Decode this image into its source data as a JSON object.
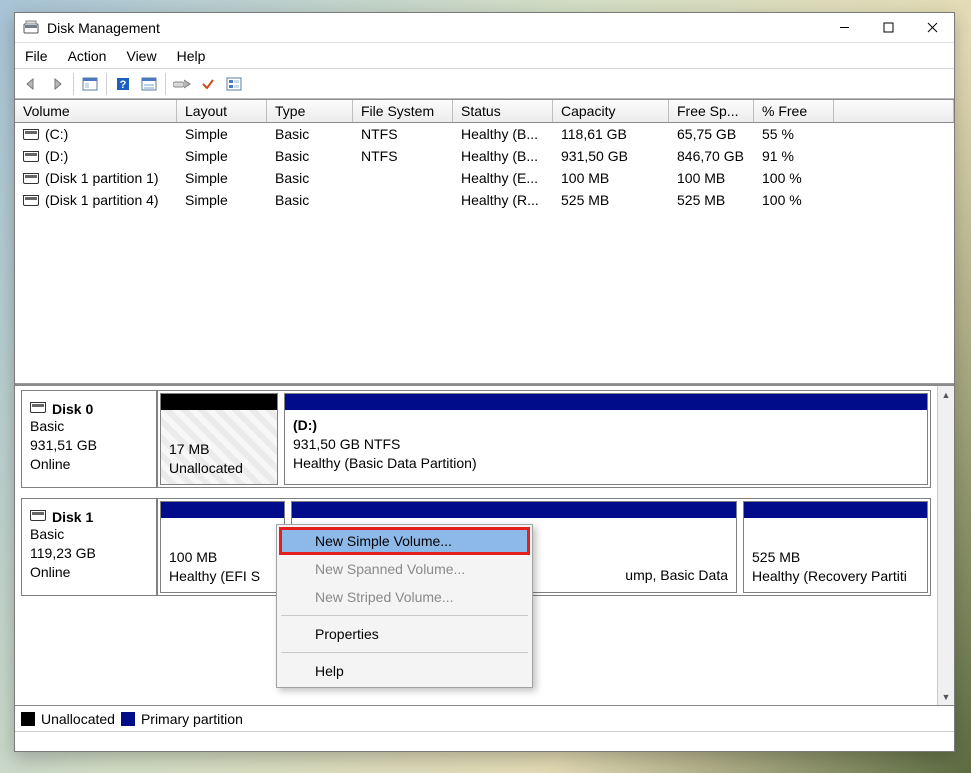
{
  "window": {
    "title": "Disk Management"
  },
  "menu": {
    "file": "File",
    "action": "Action",
    "view": "View",
    "help": "Help"
  },
  "vol": {
    "cols": [
      "Volume",
      "Layout",
      "Type",
      "File System",
      "Status",
      "Capacity",
      "Free Sp...",
      "% Free"
    ],
    "rows": [
      {
        "name": "(C:)",
        "layout": "Simple",
        "type": "Basic",
        "fs": "NTFS",
        "status": "Healthy (B...",
        "cap": "118,61 GB",
        "free": "65,75 GB",
        "pct": "55 %"
      },
      {
        "name": "(D:)",
        "layout": "Simple",
        "type": "Basic",
        "fs": "NTFS",
        "status": "Healthy (B...",
        "cap": "931,50 GB",
        "free": "846,70 GB",
        "pct": "91 %"
      },
      {
        "name": "(Disk 1 partition 1)",
        "layout": "Simple",
        "type": "Basic",
        "fs": "",
        "status": "Healthy (E...",
        "cap": "100 MB",
        "free": "100 MB",
        "pct": "100 %"
      },
      {
        "name": "(Disk 1 partition 4)",
        "layout": "Simple",
        "type": "Basic",
        "fs": "",
        "status": "Healthy (R...",
        "cap": "525 MB",
        "free": "525 MB",
        "pct": "100 %"
      }
    ]
  },
  "disks": {
    "d0": {
      "name": "Disk 0",
      "type": "Basic",
      "size": "931,51 GB",
      "state": "Online",
      "p0": {
        "size": "17 MB",
        "status": "Unallocated"
      },
      "p1": {
        "label": "(D:)",
        "size": "931,50 GB NTFS",
        "status": "Healthy (Basic Data Partition)"
      }
    },
    "d1": {
      "name": "Disk 1",
      "type": "Basic",
      "size": "119,23 GB",
      "state": "Online",
      "p0": {
        "size": "100 MB",
        "status": "Healthy (EFI S"
      },
      "p1": {
        "status": "ump, Basic Data"
      },
      "p2": {
        "size": "525 MB",
        "status": "Healthy (Recovery Partiti"
      }
    }
  },
  "legend": {
    "unalloc": "Unallocated",
    "primary": "Primary partition"
  },
  "ctx": {
    "simple": "New Simple Volume...",
    "spanned": "New Spanned Volume...",
    "striped": "New Striped Volume...",
    "props": "Properties",
    "help": "Help"
  }
}
